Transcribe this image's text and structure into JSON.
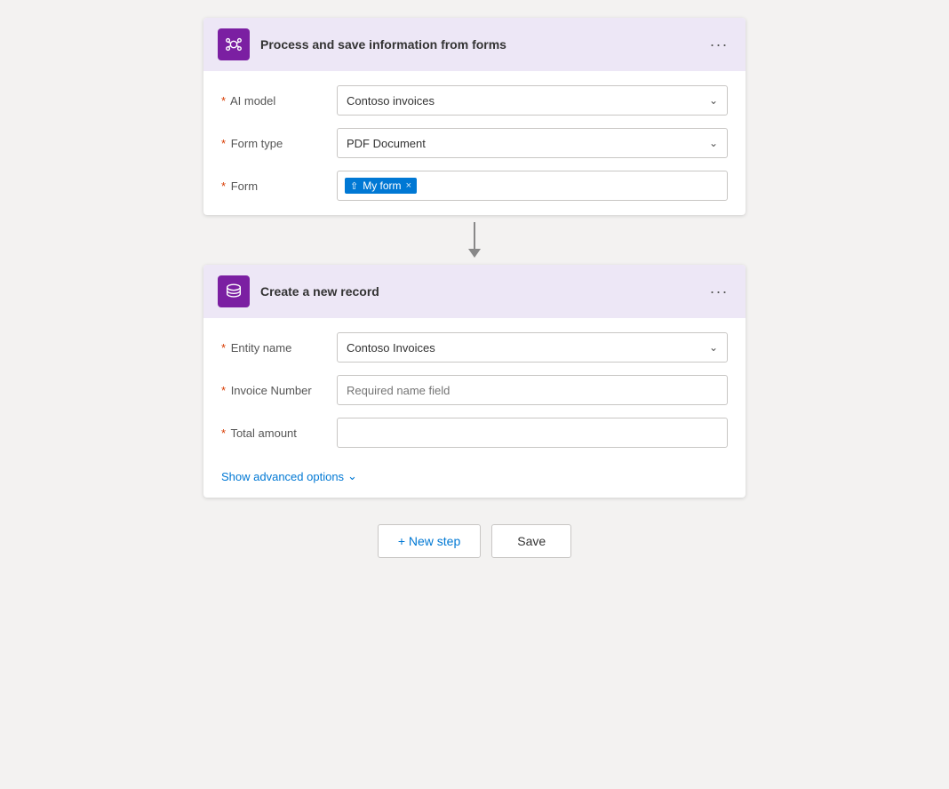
{
  "card1": {
    "title": "Process and save information from forms",
    "more_btn_label": "···",
    "fields": {
      "ai_model": {
        "label": "AI model",
        "value": "Contoso invoices"
      },
      "form_type": {
        "label": "Form type",
        "value": "PDF Document"
      },
      "form": {
        "label": "Form",
        "tag_label": "My form",
        "tag_close": "×"
      }
    }
  },
  "card2": {
    "title": "Create a new record",
    "more_btn_label": "···",
    "fields": {
      "entity_name": {
        "label": "Entity name",
        "value": "Contoso Invoices"
      },
      "invoice_number": {
        "label": "Invoice Number",
        "placeholder": "Required name field"
      },
      "total_amount": {
        "label": "Total amount",
        "placeholder": ""
      }
    },
    "advanced_options": "Show advanced options"
  },
  "bottom_actions": {
    "new_step": "+ New step",
    "save": "Save"
  }
}
